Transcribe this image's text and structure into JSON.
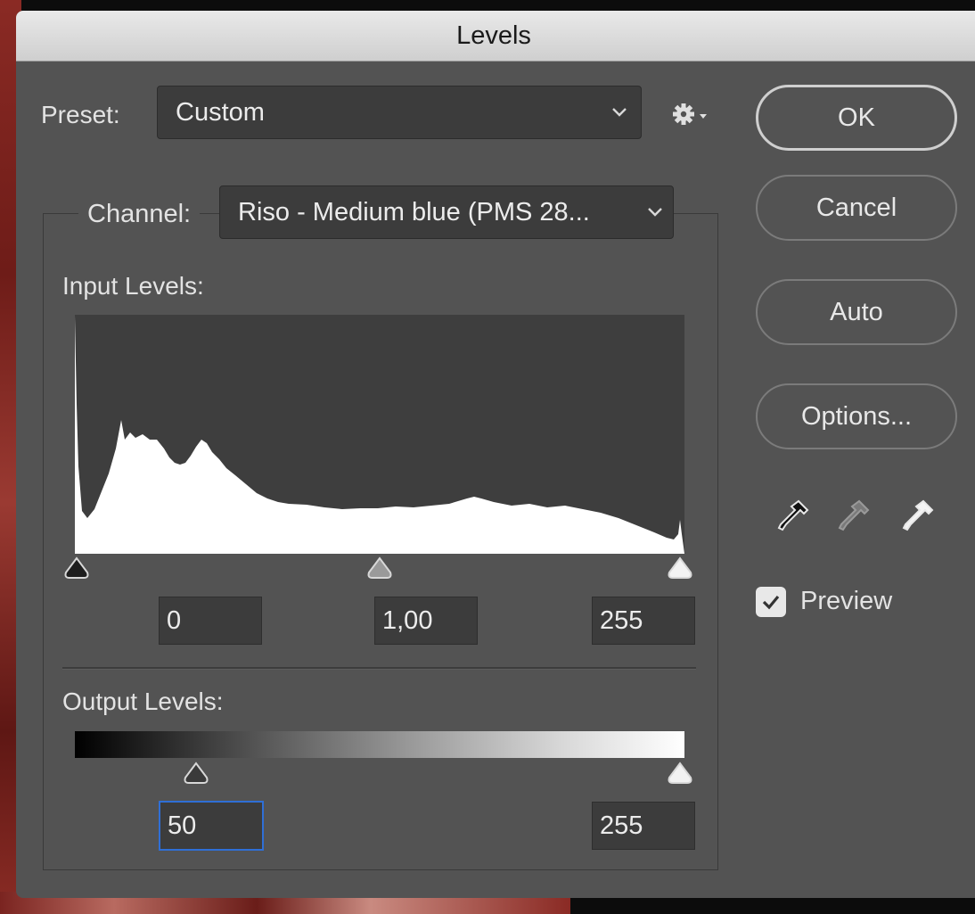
{
  "dialog": {
    "title": "Levels"
  },
  "preset": {
    "label": "Preset:",
    "value": "Custom"
  },
  "channel": {
    "label": "Channel:",
    "value": "Riso - Medium blue (PMS 28..."
  },
  "buttons": {
    "ok": "OK",
    "cancel": "Cancel",
    "auto": "Auto",
    "options": "Options..."
  },
  "input_levels": {
    "label": "Input Levels:",
    "black": "0",
    "gamma": "1,00",
    "white": "255"
  },
  "output_levels": {
    "label": "Output Levels:",
    "black": "50",
    "white": "255"
  },
  "preview": {
    "label": "Preview",
    "checked": true
  },
  "icons": {
    "gear": "gear-icon",
    "black_eyedropper": "black-point-eyedropper-icon",
    "gray_eyedropper": "gray-point-eyedropper-icon",
    "white_eyedropper": "white-point-eyedropper-icon"
  },
  "colors": {
    "dialog_bg": "#535353",
    "focus_ring": "#2f6fd6",
    "histogram_fill": "#ffffff"
  }
}
